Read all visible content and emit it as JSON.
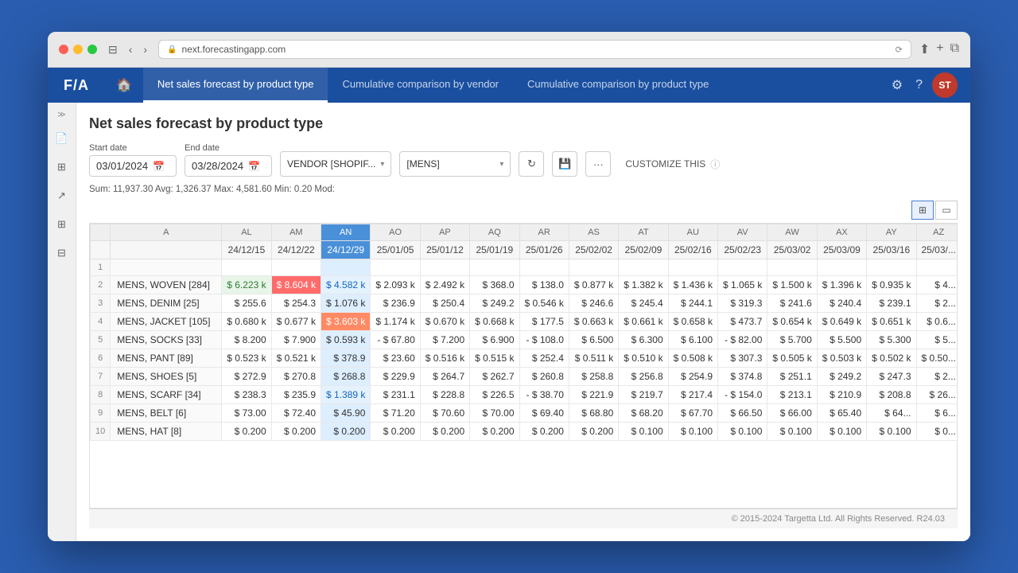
{
  "browser": {
    "url": "next.forecastingapp.com",
    "refresh_icon": "⟳"
  },
  "app": {
    "logo": "F/A",
    "nav_tabs": [
      {
        "id": "tab1",
        "label": "Net sales forecast by product type",
        "active": true
      },
      {
        "id": "tab2",
        "label": "Cumulative comparison by vendor",
        "active": false
      },
      {
        "id": "tab3",
        "label": "Cumulative comparison by product type",
        "active": false
      }
    ],
    "avatar": "ST"
  },
  "page": {
    "title": "Net sales forecast by product type",
    "stats": "Sum: 11,937.30  Avg: 1,326.37  Max: 4,581.60  Min: 0.20  Mod:",
    "start_date_label": "Start date",
    "start_date": "03/01/2024",
    "end_date_label": "End date",
    "end_date": "03/28/2024",
    "vendor_filter": "VENDOR [SHOPIF...",
    "category_filter": "[MENS]",
    "customize_label": "CUSTOMIZE THIS"
  },
  "columns": {
    "alpha_headers": [
      "A",
      "AL",
      "AM",
      "AN",
      "AO",
      "AP",
      "AQ",
      "AR",
      "AS",
      "AT",
      "AU",
      "AV",
      "AW",
      "AX",
      "AY",
      "AZ"
    ],
    "date_headers": [
      "",
      "24/12/15",
      "24/12/22",
      "24/12/29",
      "25/01/05",
      "25/01/12",
      "25/01/19",
      "25/01/26",
      "25/02/02",
      "25/02/09",
      "25/02/16",
      "25/02/23",
      "25/03/02",
      "25/03/09",
      "25/03/16",
      "25/03/..."
    ]
  },
  "rows": [
    {
      "num": "1",
      "name": "",
      "values": [
        "",
        "",
        "",
        "",
        "",
        "",
        "",
        "",
        "",
        "",
        "",
        "",
        "",
        "",
        ""
      ]
    },
    {
      "num": "2",
      "name": "MENS, WOVEN [284]",
      "values": [
        "$ 6.223 k",
        "$ 8.604 k",
        "$ 4.582 k",
        "$ 2.093 k",
        "$ 2.492 k",
        "$ 368.0",
        "$ 138.0",
        "$ 0.877 k",
        "$ 1.382 k",
        "$ 1.436 k",
        "$ 1.065 k",
        "$ 1.500 k",
        "$ 1.396 k",
        "$ 0.935 k",
        "$ 4..."
      ],
      "styles": [
        "cell-green",
        "cell-red",
        "cell-blue",
        "",
        "",
        "",
        "",
        "",
        "",
        "",
        "",
        "",
        "",
        "",
        ""
      ]
    },
    {
      "num": "3",
      "name": "MENS, DENIM [25]",
      "values": [
        "$ 255.6",
        "$ 254.3",
        "$ 1.076 k",
        "$ 236.9",
        "$ 250.4",
        "$ 249.2",
        "$ 0.546 k",
        "$ 246.6",
        "$ 245.4",
        "$ 244.1",
        "$ 319.3",
        "$ 241.6",
        "$ 240.4",
        "$ 239.1",
        "$ 2..."
      ],
      "styles": [
        "",
        "",
        "",
        "",
        "",
        "",
        "",
        "",
        "",
        "",
        "",
        "",
        "",
        "",
        ""
      ]
    },
    {
      "num": "4",
      "name": "MENS, JACKET [105]",
      "values": [
        "$ 0.680 k",
        "$ 0.677 k",
        "$ 3.603 k",
        "$ 1.174 k",
        "$ 0.670 k",
        "$ 0.668 k",
        "$ 177.5",
        "$ 0.663 k",
        "$ 0.661 k",
        "$ 0.658 k",
        "$ 473.7",
        "$ 0.654 k",
        "$ 0.649 k",
        "$ 0.651 k",
        "$ 0.6..."
      ],
      "styles": [
        "",
        "",
        "cell-red",
        "",
        "",
        "",
        "",
        "",
        "",
        "",
        "",
        "",
        "",
        "",
        ""
      ]
    },
    {
      "num": "5",
      "name": "MENS, SOCKS [33]",
      "values": [
        "$ 8.200",
        "$ 7.900",
        "$ 0.593 k",
        "- $ 67.80",
        "$ 7.200",
        "$ 6.900",
        "- $ 108.0",
        "$ 6.500",
        "$ 6.300",
        "$ 6.100",
        "- $ 82.00",
        "$ 5.700",
        "$ 5.500",
        "$ 5.300",
        "$ 5..."
      ],
      "styles": [
        "",
        "",
        "",
        "",
        "",
        "",
        "",
        "",
        "",
        "",
        "",
        "",
        "",
        "",
        ""
      ]
    },
    {
      "num": "6",
      "name": "MENS, PANT [89]",
      "values": [
        "$ 0.523 k",
        "$ 0.521 k",
        "$ 378.9",
        "$ 23.60",
        "$ 0.516 k",
        "$ 0.515 k",
        "$ 252.4",
        "$ 0.511 k",
        "$ 0.510 k",
        "$ 0.508 k",
        "$ 307.3",
        "$ 0.505 k",
        "$ 0.503 k",
        "$ 0.502 k",
        "$ 0.50..."
      ],
      "styles": [
        "",
        "",
        "",
        "",
        "",
        "",
        "",
        "",
        "",
        "",
        "",
        "",
        "",
        "",
        ""
      ]
    },
    {
      "num": "7",
      "name": "MENS, SHOES [5]",
      "values": [
        "$ 272.9",
        "$ 270.8",
        "$ 268.8",
        "$ 229.9",
        "$ 264.7",
        "$ 262.7",
        "$ 260.8",
        "$ 258.8",
        "$ 256.8",
        "$ 254.9",
        "$ 374.8",
        "$ 251.1",
        "$ 249.2",
        "$ 247.3",
        "$ 2..."
      ],
      "styles": [
        "",
        "",
        "",
        "",
        "",
        "",
        "",
        "",
        "",
        "",
        "",
        "",
        "",
        "",
        ""
      ]
    },
    {
      "num": "8",
      "name": "MENS, SCARF [34]",
      "values": [
        "$ 238.3",
        "$ 235.9",
        "$ 1.389 k",
        "$ 231.1",
        "$ 228.8",
        "$ 226.5",
        "- $ 38.70",
        "$ 221.9",
        "$ 219.7",
        "$ 217.4",
        "- $ 154.0",
        "$ 213.1",
        "$ 210.9",
        "$ 208.8",
        "$ 26..."
      ],
      "styles": [
        "",
        "",
        "cell-blue",
        "",
        "",
        "",
        "",
        "",
        "",
        "",
        "",
        "",
        "",
        "",
        ""
      ]
    },
    {
      "num": "9",
      "name": "MENS, BELT [6]",
      "values": [
        "$ 73.00",
        "$ 72.40",
        "$ 45.90",
        "$ 71.20",
        "$ 70.60",
        "$ 70.00",
        "$ 69.40",
        "$ 68.80",
        "$ 68.20",
        "$ 67.70",
        "$ 66.50",
        "$ 66.00",
        "$ 65.40",
        "$ 64..."
      ],
      "styles": [
        "",
        "",
        "",
        "",
        "",
        "",
        "",
        "",
        "",
        "",
        "",
        "",
        "",
        "",
        ""
      ]
    },
    {
      "num": "10",
      "name": "MENS, HAT [8]",
      "values": [
        "$ 0.200",
        "$ 0.200",
        "$ 0.200",
        "$ 0.200",
        "$ 0.200",
        "$ 0.200",
        "$ 0.200",
        "$ 0.200",
        "$ 0.100",
        "$ 0.100",
        "$ 0.100",
        "$ 0.100",
        "$ 0.100",
        "$ 0.100",
        "$ 0..."
      ],
      "styles": [
        "",
        "",
        "",
        "",
        "",
        "",
        "",
        "",
        "",
        "",
        "",
        "",
        "",
        "",
        ""
      ]
    }
  ],
  "footer": {
    "copyright": "© 2015-2024 Targetta Ltd. All Rights Reserved. R24.03"
  },
  "sidebar_icons": [
    "expand",
    "image",
    "table",
    "share",
    "grid",
    "copy"
  ]
}
